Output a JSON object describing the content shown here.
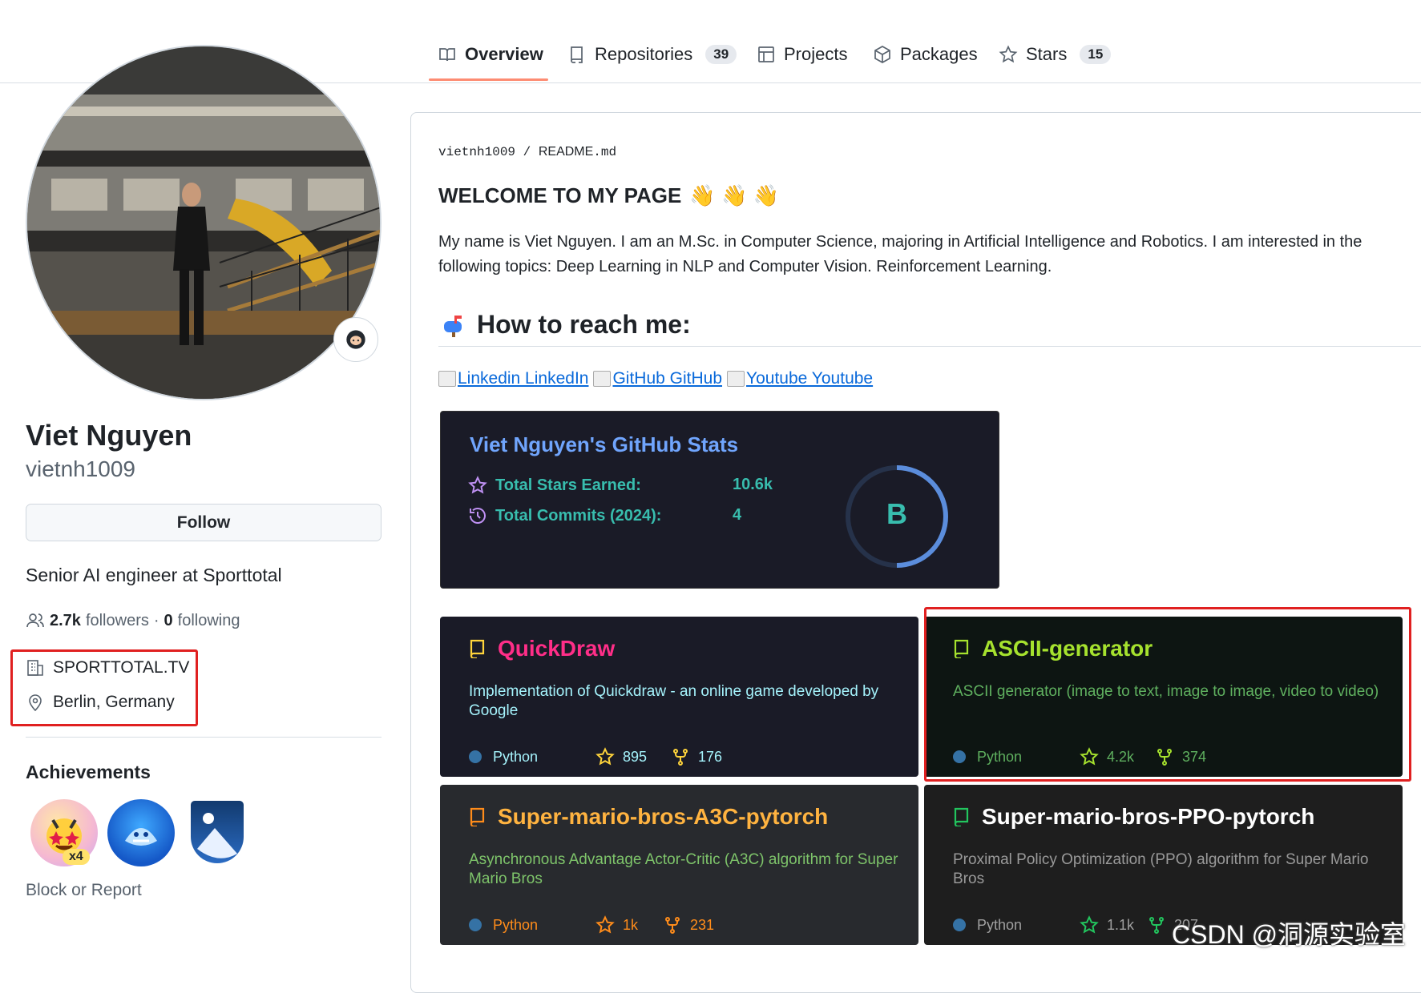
{
  "tabs": [
    {
      "label": "Overview",
      "count": "",
      "icon": "book-icon"
    },
    {
      "label": "Repositories",
      "count": "39",
      "icon": "repo-icon"
    },
    {
      "label": "Projects",
      "count": "",
      "icon": "table-icon"
    },
    {
      "label": "Packages",
      "count": "",
      "icon": "package-icon"
    },
    {
      "label": "Stars",
      "count": "15",
      "icon": "star-icon"
    }
  ],
  "profile": {
    "name": "Viet Nguyen",
    "login": "vietnh1009",
    "follow_label": "Follow",
    "bio": "Senior AI engineer at Sporttotal",
    "followers_count": "2.7k",
    "followers_label": "followers",
    "separator": "·",
    "following_count": "0",
    "following_label": "following",
    "company": "SPORTTOTAL.TV",
    "location": "Berlin, Germany",
    "achievements_title": "Achievements",
    "achievement_multiplier": "x4",
    "block_label": "Block or Report"
  },
  "readme": {
    "owner": "vietnh1009",
    "slash": "/",
    "file": "README",
    "ext": ".md",
    "welcome": "WELCOME TO MY PAGE",
    "wave": "👋 👋 👋",
    "intro": "My name is Viet Nguyen. I am an M.Sc. in Computer Science, majoring in Artificial Intelligence and Robotics. I am interested in the following topics: Deep Learning in NLP and Computer Vision. Reinforcement Learning.",
    "reach_title": "How to reach me:",
    "links": [
      "Linkedin LinkedIn",
      "GitHub GitHub",
      "Youtube Youtube"
    ]
  },
  "stats": {
    "title": "Viet Nguyen's GitHub Stats",
    "stars_label": "Total Stars Earned:",
    "stars_value": "10.6k",
    "commits_label": "Total Commits (2024):",
    "commits_value": "4",
    "grade": "B",
    "colors": {
      "bg": "#1a1b27",
      "title": "#70a5fd",
      "text": "#38bdae",
      "icon": "#bf91f3"
    }
  },
  "repos": [
    {
      "name": "QuickDraw",
      "desc": "Implementation of Quickdraw - an online game developed by Google",
      "lang": "Python",
      "stars": "895",
      "forks": "176",
      "bg": "#1a1b27",
      "title_color": "#ff2e88",
      "text_color": "#a5f3fc",
      "icon_color": "#ffd43b",
      "meta_color": "#a5f3fc"
    },
    {
      "name": "ASCII-generator",
      "desc": "ASCII generator (image to text, image to image, video to video)",
      "lang": "Python",
      "stars": "4.2k",
      "forks": "374",
      "bg": "#0d1512",
      "title_color": "#a6e22e",
      "text_color": "#5fb05f",
      "icon_color": "#a6e22e",
      "meta_color": "#5fb05f"
    },
    {
      "name": "Super-mario-bros-A3C-pytorch",
      "desc": "Asynchronous Advantage Actor-Critic (A3C) algorithm for Super Mario Bros",
      "lang": "Python",
      "stars": "1k",
      "forks": "231",
      "bg": "#282a2e",
      "title_color": "#ffb340",
      "text_color": "#7ec46a",
      "icon_color": "#ff8c1a",
      "meta_color": "#ff8c1a"
    },
    {
      "name": "Super-mario-bros-PPO-pytorch",
      "desc": "Proximal Policy Optimization (PPO) algorithm for Super Mario Bros",
      "lang": "Python",
      "stars": "1.1k",
      "forks": "207",
      "bg": "#1e1e1e",
      "title_color": "#ffffff",
      "text_color": "#9a9a9a",
      "icon_color": "#22c55e",
      "meta_color": "#a0a0a0"
    }
  ],
  "watermark": "CSDN @洞源实验室"
}
